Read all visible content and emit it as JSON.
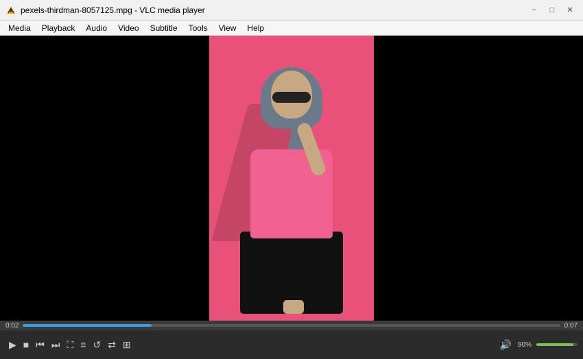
{
  "titleBar": {
    "title": "pexels-thirdman-8057125.mpg - VLC media player",
    "icon": "vlc-icon",
    "minimize": "−",
    "maximize": "□",
    "close": "✕"
  },
  "menuBar": {
    "items": [
      "Media",
      "Playback",
      "Audio",
      "Video",
      "Subtitle",
      "Tools",
      "View",
      "Help"
    ]
  },
  "controls": {
    "timeStart": "0:02",
    "timeEnd": "0:07",
    "volumePercent": "90%",
    "playBtn": "▶",
    "stopBtn": "■",
    "prevBtn": "⏮",
    "nextBtn": "⏭",
    "fullscreenBtn": "⛶",
    "extendedBtn": "≡",
    "loopBtn": "↺",
    "randomBtn": "⇄",
    "toggleBtn": "⊞",
    "volumeIcon": "🔊"
  }
}
